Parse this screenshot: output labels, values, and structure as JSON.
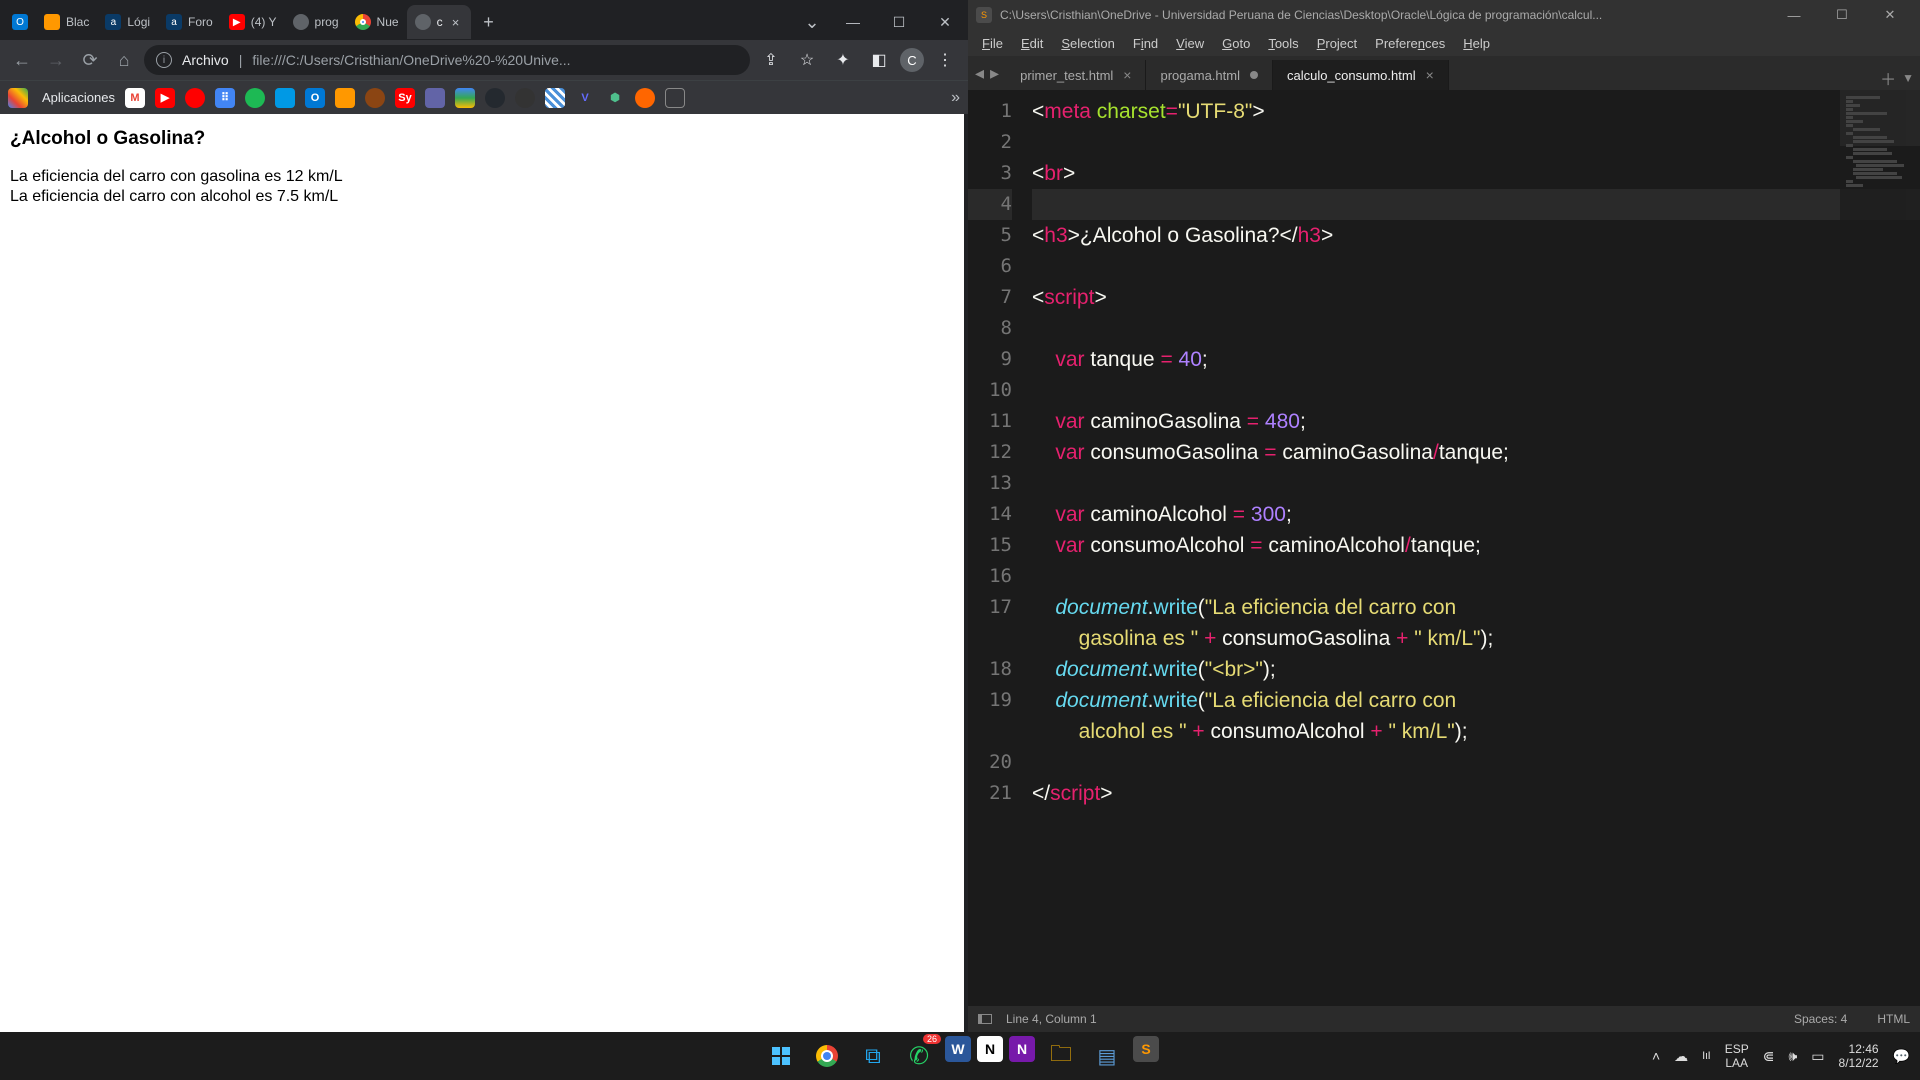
{
  "chrome": {
    "tabs": [
      {
        "icon_bg": "#0078d4",
        "icon_txt": "O",
        "label": ""
      },
      {
        "icon_bg": "#ff9800",
        "icon_txt": "",
        "label": "Blac"
      },
      {
        "icon_bg": "#0a3a66",
        "icon_txt": "a",
        "label": "Lógi"
      },
      {
        "icon_bg": "#0a3a66",
        "icon_txt": "a",
        "label": "Foro"
      },
      {
        "icon_bg": "#ff0000",
        "icon_txt": "▶",
        "label": "(4) Y"
      },
      {
        "icon_bg": "#5f6368",
        "icon_txt": "",
        "label": "prog"
      },
      {
        "icon_bg": "#ffffff",
        "icon_txt": "",
        "label": "Nue"
      },
      {
        "icon_bg": "#5f6368",
        "icon_txt": "",
        "label": "c"
      }
    ],
    "omnibox_label": "Archivo",
    "omnibox_url": "file:///C:/Users/Cristhian/OneDrive%20-%20Unive...",
    "bookmarks_label": "Aplicaciones",
    "profile_letter": "C",
    "page": {
      "heading": "¿Alcohol o Gasolina?",
      "line1": "La eficiencia del carro con gasolina es 12 km/L",
      "line2": "La eficiencia del carro con alcohol es 7.5 km/L"
    }
  },
  "sublime": {
    "title": "C:\\Users\\Cristhian\\OneDrive - Universidad Peruana de Ciencias\\Desktop\\Oracle\\Lógica de programación\\calcul...",
    "menus": [
      "File",
      "Edit",
      "Selection",
      "Find",
      "View",
      "Goto",
      "Tools",
      "Project",
      "Preferences",
      "Help"
    ],
    "tabs": [
      {
        "name": "primer_test.html",
        "state": "close"
      },
      {
        "name": "progama.html",
        "state": "dirty"
      },
      {
        "name": "calculo_consumo.html",
        "state": "close",
        "active": true
      }
    ],
    "status_left": "Line 4, Column 1",
    "status_spaces": "Spaces: 4",
    "status_lang": "HTML"
  },
  "taskbar": {
    "whatsapp_badge": "26",
    "lang1": "ESP",
    "lang2": "LAA",
    "time": "12:46",
    "date": "8/12/22"
  }
}
